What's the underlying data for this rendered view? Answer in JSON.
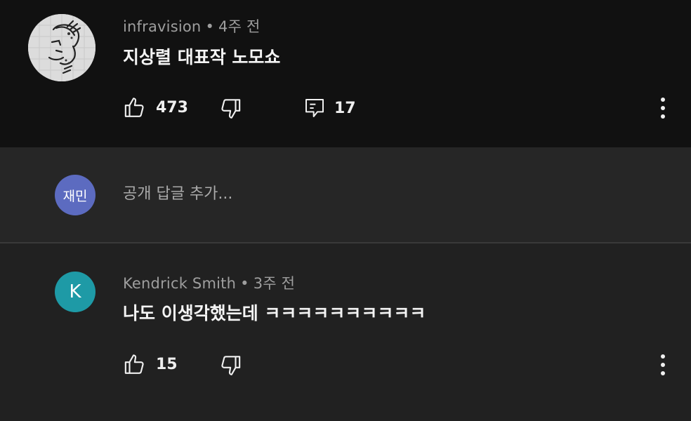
{
  "comment1": {
    "author": "infravision",
    "separator": "•",
    "time": "4주 전",
    "text": "지상렬 대표작 노모쇼",
    "likes": "473",
    "replies": "17",
    "avatar_icon": "sketch-portrait-avatar"
  },
  "reply_box": {
    "avatar_text": "재민",
    "avatar_color": "#5c6bc0",
    "placeholder": "공개 답글 추가..."
  },
  "comment2": {
    "author": "Kendrick Smith",
    "separator": "•",
    "time": "3주 전",
    "text": "나도 이생각했는데 ㅋㅋㅋㅋㅋㅋㅋㅋㅋㅋ",
    "likes": "15",
    "avatar_text": "K",
    "avatar_color": "#1e9aa6"
  },
  "icons": {
    "like": "thumbs-up-icon",
    "dislike": "thumbs-down-icon",
    "reply": "comment-icon",
    "more": "more-vertical-icon"
  }
}
